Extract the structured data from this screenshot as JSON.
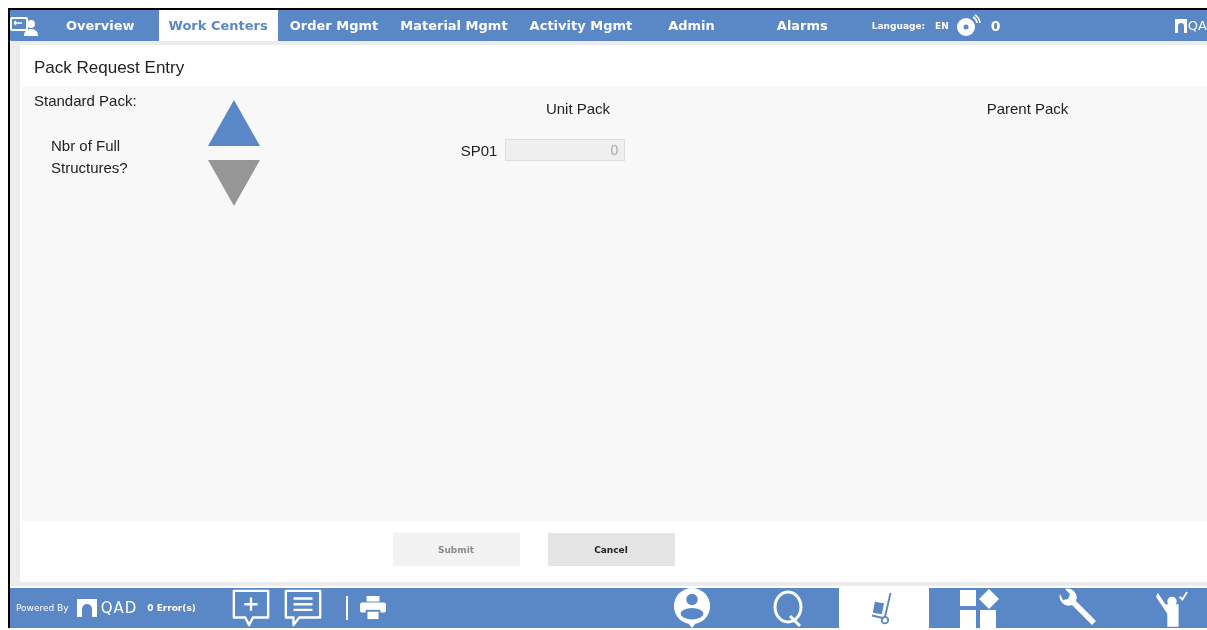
{
  "nav": {
    "tabs": [
      {
        "label": "Overview",
        "selected": false
      },
      {
        "label": "Work Centers",
        "selected": true
      },
      {
        "label": "Order Mgmt",
        "selected": false
      },
      {
        "label": "Material Mgmt",
        "selected": false
      },
      {
        "label": "Activity Mgmt",
        "selected": false
      },
      {
        "label": "Admin",
        "selected": false
      },
      {
        "label": "Alarms",
        "selected": false
      }
    ],
    "language_label": "Language:",
    "language": "EN",
    "alarm_count": "0",
    "logo_text": "QA"
  },
  "form": {
    "title": "Pack Request Entry",
    "standard_pack_label": "Standard Pack:",
    "question": "Nbr of Full Structures?",
    "stepper": [
      {
        "kind": "up",
        "disabled": false
      },
      {
        "kind": "down",
        "disabled": true
      }
    ],
    "unit_pack": {
      "heading": "Unit Pack",
      "field_label": "SP01",
      "value": "0"
    },
    "parent_pack": {
      "heading": "Parent Pack"
    },
    "buttons": [
      {
        "label": "Submit",
        "disabled": true
      },
      {
        "label": "Cancel",
        "disabled": false
      }
    ]
  },
  "footer": {
    "powered_by": "Powered By",
    "logo_text": "QAD",
    "errors": "0 Error(s)",
    "tools": [
      {
        "kind": "add-note"
      },
      {
        "kind": "notes"
      },
      {
        "kind": "print"
      }
    ],
    "tabs": [
      {
        "kind": "person",
        "selected": false
      },
      {
        "kind": "quality",
        "selected": false
      },
      {
        "kind": "cart",
        "selected": true
      },
      {
        "kind": "blocks",
        "selected": false
      },
      {
        "kind": "wrench",
        "selected": false
      },
      {
        "kind": "check-person",
        "selected": false
      }
    ]
  }
}
